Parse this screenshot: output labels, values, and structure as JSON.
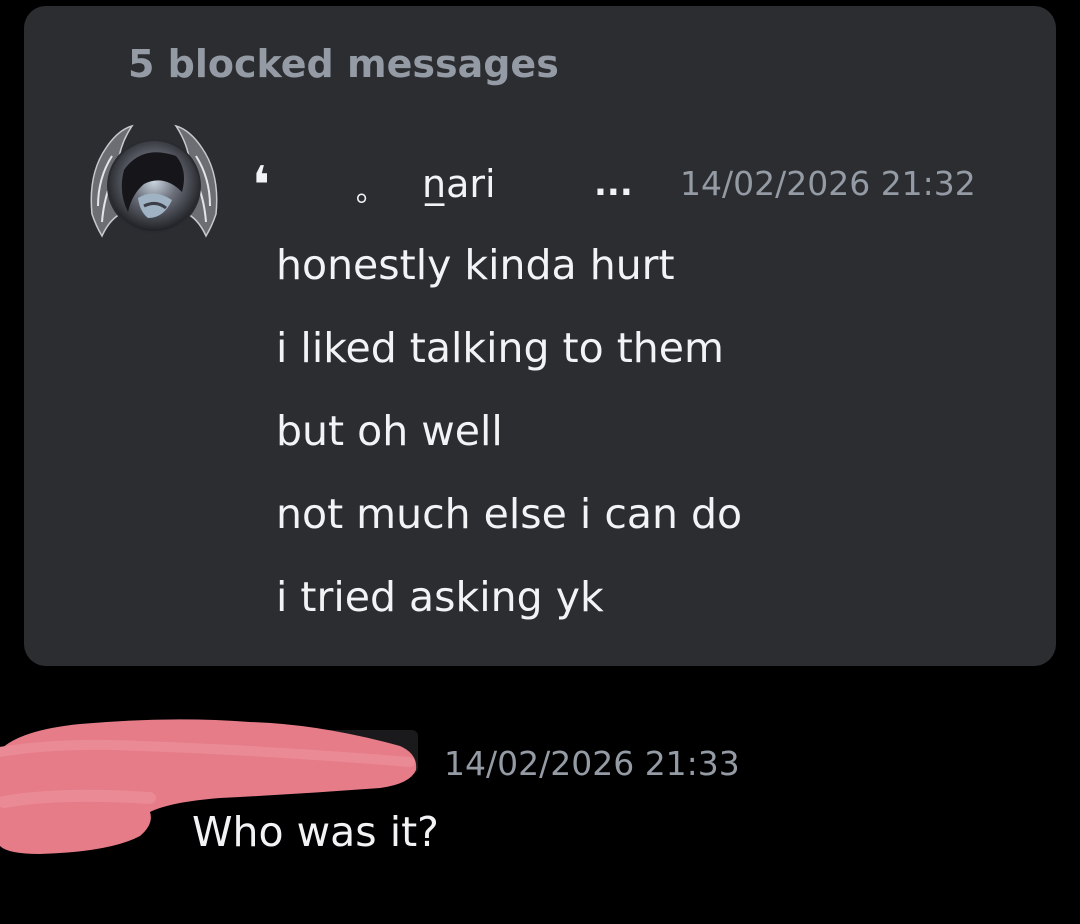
{
  "colors": {
    "background": "#000000",
    "card": "#2b2d31",
    "muted_text": "#949ba4",
    "message_text": "#f2f3f5",
    "redaction": "#e57c88"
  },
  "blocked_group": {
    "title": "5 blocked messages",
    "author": {
      "avatar_icon": "winged-avatar-icon",
      "prefix_quote": "❛",
      "prefix_dot": "｡",
      "name": "n̲ari",
      "suffix": "...",
      "timestamp": "14/02/2026 21:32"
    },
    "messages": [
      "honestly kinda hurt",
      "i liked talking to them",
      "but oh well",
      "not much else i can do",
      "i tried asking yk"
    ]
  },
  "reply": {
    "timestamp": "14/02/2026 21:33",
    "text": "Who was it?"
  }
}
